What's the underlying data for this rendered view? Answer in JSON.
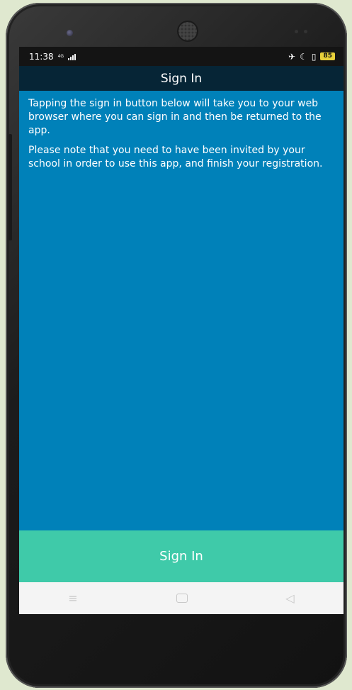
{
  "status": {
    "time": "11:38",
    "network": "4G",
    "battery": "85"
  },
  "appbar": {
    "title": "Sign In"
  },
  "content": {
    "paragraph1": "Tapping the sign in button below will take you to your web browser where you can sign in and then be returned to the app.",
    "paragraph2": "Please note that you need to have been invited by your school in order to use this app, and finish your registration."
  },
  "signin_button": {
    "label": "Sign In"
  },
  "navigation": {
    "menu_icon": "≡",
    "back_icon": "◁"
  },
  "colors": {
    "primary": "#0081b9",
    "appbar": "#062536",
    "button": "#3fcaa9",
    "background": "#dfe8cf"
  }
}
